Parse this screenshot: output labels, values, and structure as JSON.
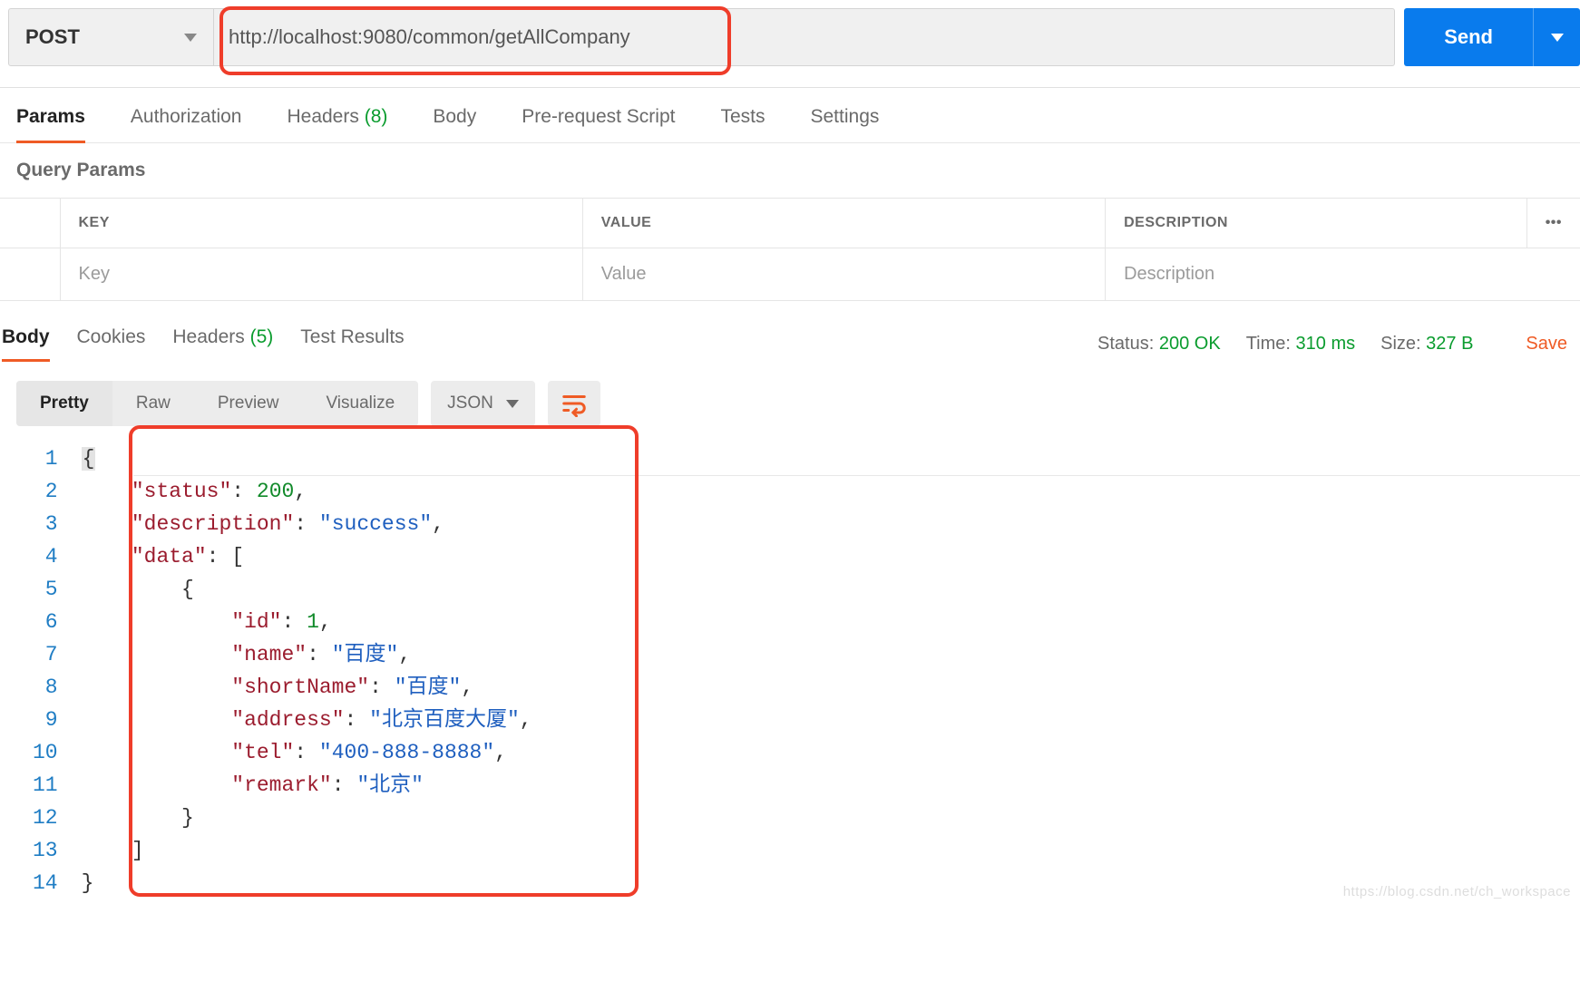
{
  "request": {
    "method": "POST",
    "url": "http://localhost:9080/common/getAllCompany",
    "send_label": "Send"
  },
  "request_tabs": {
    "items": [
      "Params",
      "Authorization",
      "Headers",
      "Body",
      "Pre-request Script",
      "Tests",
      "Settings"
    ],
    "headers_count": "(8)",
    "active": "Params"
  },
  "query_params": {
    "title": "Query Params",
    "headers": {
      "key": "KEY",
      "value": "VALUE",
      "description": "DESCRIPTION"
    },
    "placeholders": {
      "key": "Key",
      "value": "Value",
      "description": "Description"
    },
    "row": {
      "key": "",
      "value": "",
      "description": ""
    }
  },
  "response_tabs": {
    "items": [
      "Body",
      "Cookies",
      "Headers",
      "Test Results"
    ],
    "headers_count": "(5)",
    "active": "Body"
  },
  "response_meta": {
    "status_label": "Status:",
    "status_value": "200 OK",
    "time_label": "Time:",
    "time_value": "310 ms",
    "size_label": "Size:",
    "size_value": "327 B",
    "save_label": "Save"
  },
  "view": {
    "modes": [
      "Pretty",
      "Raw",
      "Preview",
      "Visualize"
    ],
    "active_mode": "Pretty",
    "format": "JSON"
  },
  "code": {
    "line_numbers": [
      "1",
      "2",
      "3",
      "4",
      "5",
      "6",
      "7",
      "8",
      "9",
      "10",
      "11",
      "12",
      "13",
      "14"
    ],
    "json_keys": {
      "status": "status",
      "description": "description",
      "data": "data",
      "id": "id",
      "name": "name",
      "shortName": "shortName",
      "address": "address",
      "tel": "tel",
      "remark": "remark"
    },
    "json_values": {
      "status": "200",
      "description": "success",
      "id": "1",
      "name": "百度",
      "shortName": "百度",
      "address": "北京百度大厦",
      "tel": "400-888-8888",
      "remark": "北京"
    }
  },
  "watermark": "https://blog.csdn.net/ch_workspace"
}
